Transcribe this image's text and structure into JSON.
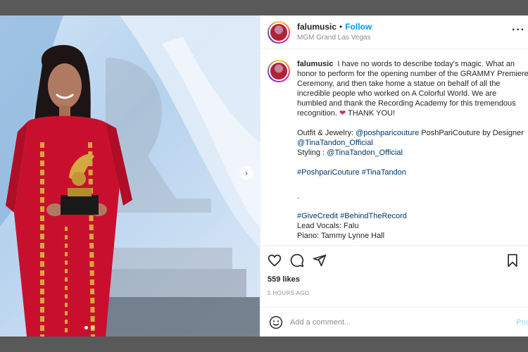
{
  "post": {
    "username": "falumusic",
    "follow_label": "Follow",
    "location": "MGM Grand Las Vegas",
    "caption_lines": [
      "I have no words to describe today's magic. What an",
      "honor to perform for the opening number of the GRAMMY Premiere",
      "Ceremony, and then take home a statue on behalf of all the",
      "incredible people who worked on A Colorful World. We are",
      "humbled and thank the Recording Academy for this tremendous",
      "recognition."
    ],
    "thank_you": "THANK YOU!",
    "outfit_label": "Outfit & Jewelry: ",
    "outfit_handle": "@poshparicouture",
    "outfit_rest": " PoshPariCouture by Designer",
    "designer_handle": "@TinaTandon_Official",
    "styling_label": "Styling : ",
    "styling_handle": "@TinaTandon_Official",
    "hashtags_1": "#PoshpariCouture #TinaTandon",
    "dot_line": ".",
    "hashtags_2": "#GiveCredit #BehindTheRecord",
    "lead_vocals": "Lead Vocals: Falu",
    "piano": "Piano: Tammy Lynne Hall",
    "likes": "559 likes",
    "time_ago": "5 HOURS AGO",
    "comment_placeholder": "Add a comment...",
    "post_label": "Post"
  },
  "icons": {
    "heart": "heart-icon",
    "comment": "comment-icon",
    "share": "share-icon",
    "save": "bookmark-icon",
    "emoji": "emoji-icon",
    "more": "more-options-icon",
    "next": "chevron-right-icon"
  },
  "colors": {
    "link": "#00376b",
    "follow": "#0095f6",
    "dress": "#c8102e"
  }
}
